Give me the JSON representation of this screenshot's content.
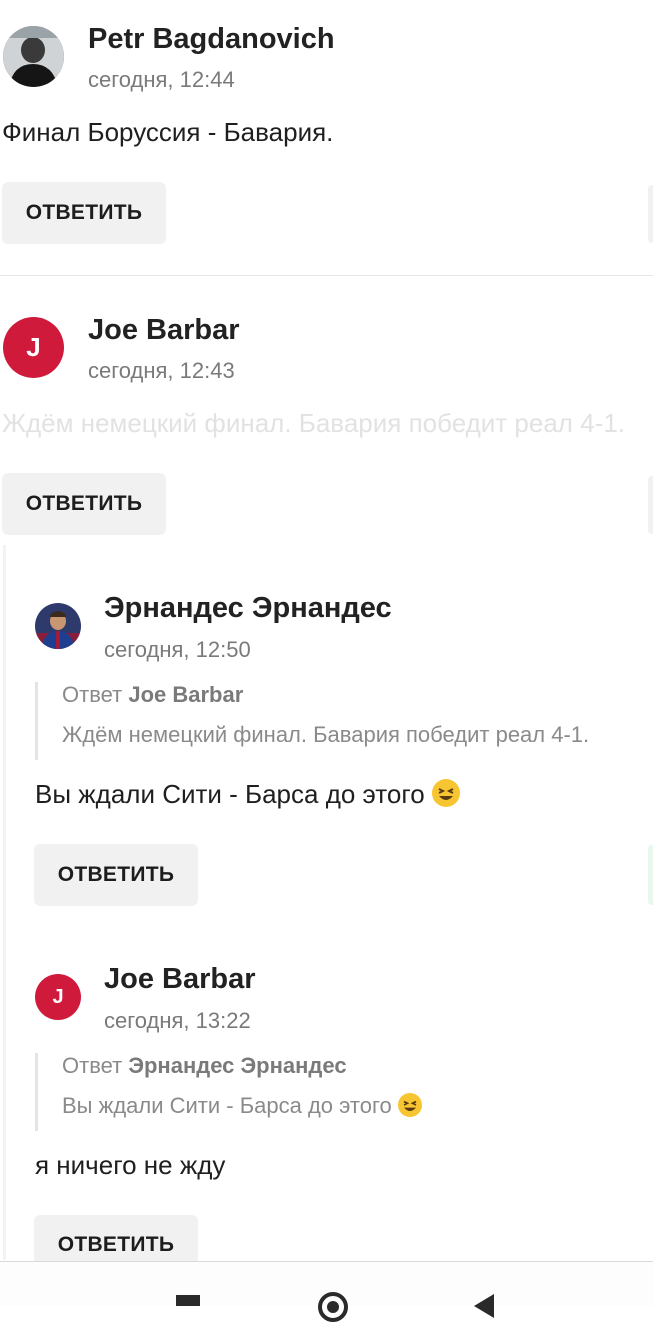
{
  "reply_label": "ОТВЕТИТЬ",
  "quote_prefix": "Ответ",
  "comments": [
    {
      "author": "Petr Bagdanovich",
      "time": "сегодня, 12:44",
      "text": "Финал Боруссия - Бавария.",
      "avatar": "photo"
    },
    {
      "author": "Joe Barbar",
      "time": "сегодня, 12:43",
      "text": "Ждём немецкий финал. Бавария победит реал 4-1.",
      "avatar_letter": "J"
    }
  ],
  "replies": [
    {
      "author": "Эрнандес Эрнандес",
      "time": "сегодня, 12:50",
      "quote_author": "Joe Barbar",
      "quote_text": "Ждём немецкий финал. Бавария победит реал 4-1.",
      "text": "Вы ждали Сити - Барса до этого",
      "emoji": "grinning-squinting-face-emoji",
      "avatar": "photo"
    },
    {
      "author": "Joe Barbar",
      "time": "сегодня, 13:22",
      "quote_author": "Эрнандес Эрнандес",
      "quote_text": "Вы ждали Сити - Барса до этого",
      "quote_emoji": "grinning-squinting-face-emoji",
      "text": "я ничего не жду",
      "avatar_letter": "J"
    }
  ],
  "colors": {
    "avatar_red": "#cf1a3c",
    "button_bg": "#f1f1f1",
    "muted_text": "#7a7a7a"
  },
  "navbar": {
    "items": [
      "square-recent-apps-icon",
      "circle-home-icon",
      "triangle-back-icon"
    ]
  }
}
